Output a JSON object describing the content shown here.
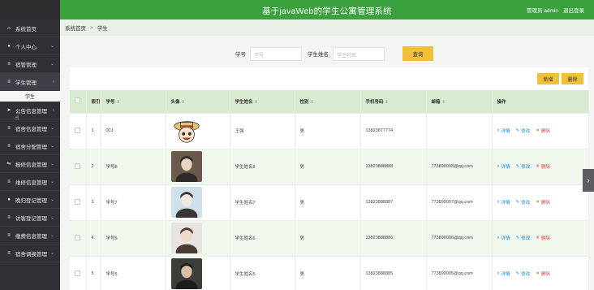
{
  "app": {
    "title": "基于javaWeb的学生公寓管理系统",
    "user": "管理员 admin",
    "logout": "退出登录"
  },
  "breadcrumb": {
    "home": "系统首页",
    "separator": ">",
    "current": "学生"
  },
  "sidebar": {
    "items": [
      {
        "icon": "home-icon",
        "glyph": "⌂",
        "label": "系统首页",
        "chevron": ""
      },
      {
        "icon": "user-icon",
        "glyph": "●",
        "label": "个人中心",
        "chevron": "⌄"
      },
      {
        "icon": "list-icon",
        "glyph": "≡",
        "label": "宿管管理",
        "chevron": "⌄"
      },
      {
        "icon": "list-icon",
        "glyph": "≡",
        "label": "学生管理",
        "chevron": "‹"
      },
      {
        "icon": "send-icon",
        "glyph": "➤",
        "label": "公告信息管理",
        "chevron": "‹"
      },
      {
        "icon": "list-icon",
        "glyph": "≡",
        "label": "宿舍信息管理",
        "chevron": "⌄"
      },
      {
        "icon": "list-icon",
        "glyph": "≡",
        "label": "宿舍分配管理",
        "chevron": "⌄"
      },
      {
        "icon": "sliders-icon",
        "glyph": "⇋",
        "label": "报修信息管理",
        "chevron": "⌄"
      },
      {
        "icon": "list-icon",
        "glyph": "≡",
        "label": "维修信息管理",
        "chevron": "⌄"
      },
      {
        "icon": "user-icon",
        "glyph": "●",
        "label": "晚归登记管理",
        "chevron": "⌄"
      },
      {
        "icon": "list-icon",
        "glyph": "≡",
        "label": "访客登记管理",
        "chevron": "⌄"
      },
      {
        "icon": "list-icon",
        "glyph": "≡",
        "label": "缴费信息管理",
        "chevron": "⌄"
      },
      {
        "icon": "list-icon",
        "glyph": "≡",
        "label": "宿舍调换管理",
        "chevron": "⌄"
      }
    ],
    "sub_item": "学生"
  },
  "search": {
    "field1_label": "学号",
    "field1_placeholder": "学号",
    "field2_label": "学生姓名",
    "field2_placeholder": "学生姓名",
    "query_button": "查询"
  },
  "actions": {
    "add": "新增",
    "delete": "删除"
  },
  "table": {
    "headers": [
      "",
      "索引",
      "学号",
      "头像",
      "学生姓名",
      "性别",
      "手机号码",
      "邮箱",
      "操作"
    ],
    "rows": [
      {
        "index": "1",
        "student_id": "001",
        "avatar": "cartoon",
        "name": "王强",
        "gender": "男",
        "phone": "13823877774",
        "email": ""
      },
      {
        "index": "2",
        "student_id": "学号8",
        "avatar": "photo-1",
        "name": "学生姓名8",
        "gender": "男",
        "phone": "13823888888",
        "email": "773890008@qq.com"
      },
      {
        "index": "3",
        "student_id": "学号7",
        "avatar": "photo-2",
        "name": "学生姓名7",
        "gender": "男",
        "phone": "13823888887",
        "email": "773890007@qq.com"
      },
      {
        "index": "4",
        "student_id": "学号6",
        "avatar": "photo-3",
        "name": "学生姓名6",
        "gender": "男",
        "phone": "13823888886",
        "email": "773890006@qq.com"
      },
      {
        "index": "5",
        "student_id": "学号5",
        "avatar": "photo-4",
        "name": "学生姓名5",
        "gender": "男",
        "phone": "13823888885",
        "email": "773890005@qq.com"
      }
    ],
    "op_view": "详情",
    "op_edit": "修改",
    "op_delete": "删除"
  },
  "colors": {
    "header": "#3aa13d",
    "sidebar": "#2f3136",
    "accent": "#f1bf3a",
    "table_head": "#d8ebd0",
    "link": "#1e8bd1",
    "danger": "#e23b3b"
  }
}
